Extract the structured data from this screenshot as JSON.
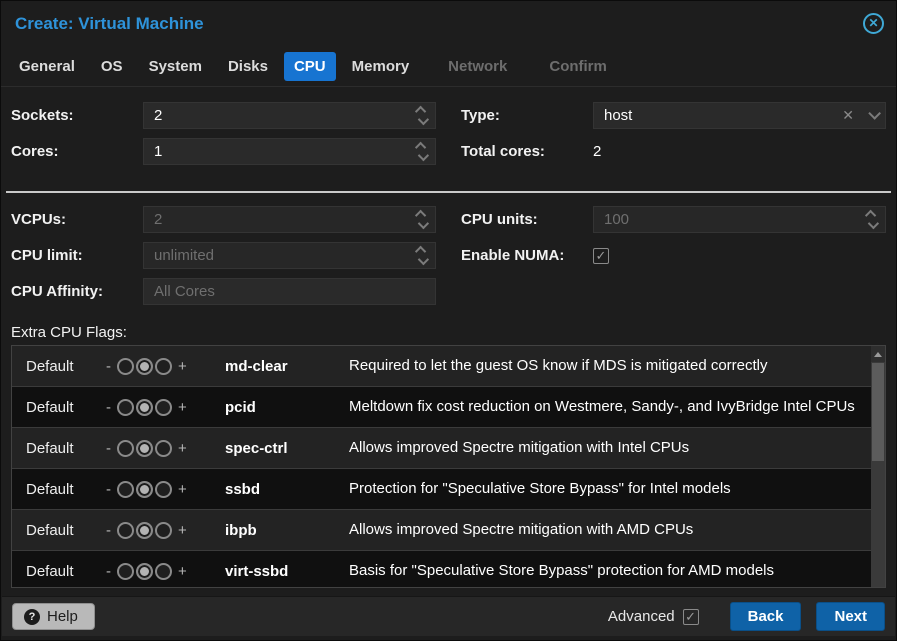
{
  "window": {
    "title": "Create: Virtual Machine"
  },
  "tabs": [
    {
      "label": "General",
      "state": "normal"
    },
    {
      "label": "OS",
      "state": "normal"
    },
    {
      "label": "System",
      "state": "normal"
    },
    {
      "label": "Disks",
      "state": "normal"
    },
    {
      "label": "CPU",
      "state": "active"
    },
    {
      "label": "Memory",
      "state": "normal"
    },
    {
      "label": "Network",
      "state": "disabled"
    },
    {
      "label": "Confirm",
      "state": "disabled"
    }
  ],
  "form": {
    "sockets": {
      "label": "Sockets:",
      "value": "2"
    },
    "cores": {
      "label": "Cores:",
      "value": "1"
    },
    "type": {
      "label": "Type:",
      "value": "host"
    },
    "total_cores": {
      "label": "Total cores:",
      "value": "2"
    },
    "vcpus": {
      "label": "VCPUs:",
      "value": "2",
      "disabled": true
    },
    "cpu_limit": {
      "label": "CPU limit:",
      "value": "unlimited",
      "disabled": true
    },
    "cpu_affinity": {
      "label": "CPU Affinity:",
      "placeholder": "All Cores"
    },
    "cpu_units": {
      "label": "CPU units:",
      "value": "100",
      "disabled": true
    },
    "enable_numa": {
      "label": "Enable NUMA:",
      "checked": true
    }
  },
  "flags": {
    "section_label": "Extra CPU Flags:",
    "slider": {
      "minus": "-",
      "plus": "+"
    },
    "rows": [
      {
        "state": "Default",
        "flag": "md-clear",
        "description": "Required to let the guest OS know if MDS is mitigated correctly"
      },
      {
        "state": "Default",
        "flag": "pcid",
        "description": "Meltdown fix cost reduction on Westmere, Sandy-, and IvyBridge Intel CPUs"
      },
      {
        "state": "Default",
        "flag": "spec-ctrl",
        "description": "Allows improved Spectre mitigation with Intel CPUs"
      },
      {
        "state": "Default",
        "flag": "ssbd",
        "description": "Protection for \"Speculative Store Bypass\" for Intel models"
      },
      {
        "state": "Default",
        "flag": "ibpb",
        "description": "Allows improved Spectre mitigation with AMD CPUs"
      },
      {
        "state": "Default",
        "flag": "virt-ssbd",
        "description": "Basis for \"Speculative Store Bypass\" protection for AMD models"
      }
    ]
  },
  "footer": {
    "help_label": "Help",
    "advanced_label": "Advanced",
    "advanced_checked": true,
    "back_label": "Back",
    "next_label": "Next"
  },
  "icons": {
    "close": "✕",
    "clear": "✕",
    "check": "✓",
    "help": "?"
  },
  "colors": {
    "title_blue": "#2e93da",
    "active_tab_blue": "#1774d1",
    "button_blue": "#0f62a7",
    "background": "#1d1d1d"
  }
}
